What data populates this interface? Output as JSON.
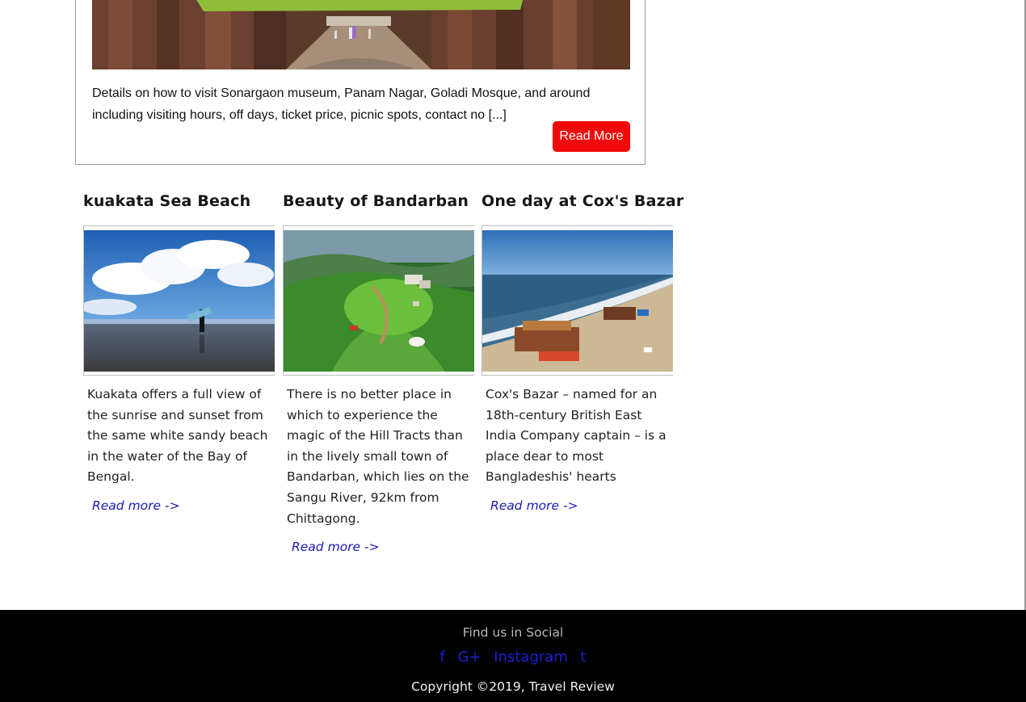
{
  "featured": {
    "excerpt": "Details on how to visit Sonargaon museum, Panam Nagar, Goladi Mosque, and around including visiting hours, off days, ticket price, picnic spots, contact no [...]",
    "read_more_label": "Read More",
    "button_color": "#f20a0a"
  },
  "posts": [
    {
      "title": "kuakata Sea Beach",
      "excerpt": "Kuakata offers a full view of the sunrise and sunset from the same white sandy beach in the water of the Bay of Bengal.",
      "link_label": "Read more ->"
    },
    {
      "title": "Beauty of Bandarban",
      "excerpt": "There is no better place in which to experience the magic of the Hill Tracts than in the lively small town of Bandarban, which lies on the Sangu River, 92km from Chittagong.",
      "link_label": "Read more ->"
    },
    {
      "title": "One day at Cox's Bazar",
      "excerpt": "Cox's Bazar – named for an 18th-century British East India Company captain – is a place dear to most Bangladeshis' hearts",
      "link_label": "Read more ->"
    }
  ],
  "footer": {
    "heading": "Find us in Social",
    "social": {
      "facebook": "f",
      "google_plus": "G+",
      "instagram": "Instagram",
      "twitter": "t"
    },
    "copyright": "Copyright ©2019, Travel Review",
    "link_color": "#1f1fd0"
  }
}
